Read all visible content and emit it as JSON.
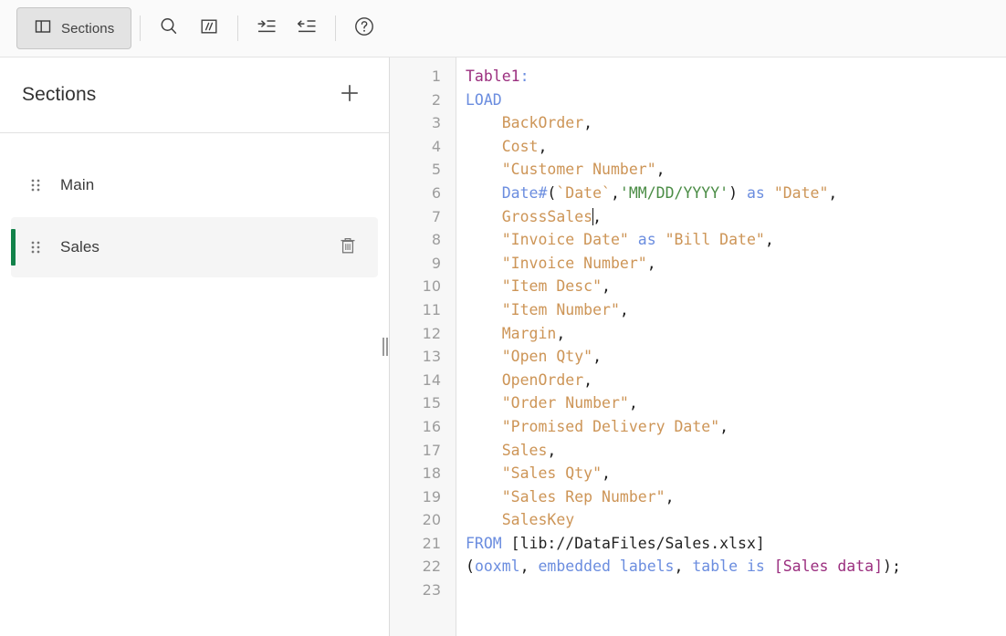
{
  "toolbar": {
    "sections_button": {
      "label": "Sections",
      "icon": "panel-layout-icon",
      "active": true
    },
    "buttons": [
      {
        "name": "search",
        "icon": "search-icon",
        "tooltip": "Search"
      },
      {
        "name": "comment",
        "icon": "comment-slashes-icon",
        "tooltip": "Comment"
      },
      {
        "name": "indent",
        "icon": "indent-right-icon",
        "tooltip": "Indent"
      },
      {
        "name": "outdent",
        "icon": "indent-left-icon",
        "tooltip": "Outdent"
      },
      {
        "name": "help",
        "icon": "help-question-icon",
        "tooltip": "Help"
      }
    ]
  },
  "sidebar": {
    "title": "Sections",
    "add_label": "+",
    "add_icon": "plus-icon",
    "accent_color": "#12824a",
    "items": [
      {
        "label": "Main",
        "selected": false,
        "deletable": false,
        "handle_icon": "drag-handle-icon"
      },
      {
        "label": "Sales",
        "selected": true,
        "deletable": true,
        "handle_icon": "drag-handle-icon",
        "delete_icon": "trash-icon"
      }
    ]
  },
  "splitter": {
    "name": "panel-splitter",
    "icon": "grip-vertical-icon"
  },
  "editor": {
    "language": "qlik-script",
    "cursor": {
      "line": 7,
      "column": 14
    },
    "line_numbers": [
      1,
      2,
      3,
      4,
      5,
      6,
      7,
      8,
      9,
      10,
      11,
      12,
      13,
      14,
      15,
      16,
      17,
      18,
      19,
      20,
      21,
      22,
      23
    ],
    "lines": [
      {
        "n": 1,
        "text": "Table1:",
        "tokens": [
          {
            "t": "Table1",
            "c": "t-table"
          },
          {
            "t": ":",
            "c": "t-kw"
          }
        ]
      },
      {
        "n": 2,
        "text": "LOAD",
        "tokens": [
          {
            "t": "LOAD",
            "c": "t-kw"
          }
        ]
      },
      {
        "n": 3,
        "text": "    BackOrder,",
        "tokens": [
          {
            "t": "    ",
            "c": "t-plain"
          },
          {
            "t": "BackOrder",
            "c": "t-field"
          },
          {
            "t": ",",
            "c": "t-punct"
          }
        ]
      },
      {
        "n": 4,
        "text": "    Cost,",
        "tokens": [
          {
            "t": "    ",
            "c": "t-plain"
          },
          {
            "t": "Cost",
            "c": "t-field"
          },
          {
            "t": ",",
            "c": "t-punct"
          }
        ]
      },
      {
        "n": 5,
        "text": "    \"Customer Number\",",
        "tokens": [
          {
            "t": "    ",
            "c": "t-plain"
          },
          {
            "t": "\"Customer Number\"",
            "c": "t-field"
          },
          {
            "t": ",",
            "c": "t-punct"
          }
        ]
      },
      {
        "n": 6,
        "text": "    Date#(`Date`,'MM/DD/YYYY') as \"Date\",",
        "tokens": [
          {
            "t": "    ",
            "c": "t-plain"
          },
          {
            "t": "Date#",
            "c": "t-kw"
          },
          {
            "t": "(",
            "c": "t-punct"
          },
          {
            "t": "`Date`",
            "c": "t-field"
          },
          {
            "t": ",",
            "c": "t-punct"
          },
          {
            "t": "'MM/DD/YYYY'",
            "c": "t-str"
          },
          {
            "t": ")",
            "c": "t-punct"
          },
          {
            "t": " ",
            "c": "t-plain"
          },
          {
            "t": "as",
            "c": "t-kw"
          },
          {
            "t": " ",
            "c": "t-plain"
          },
          {
            "t": "\"Date\"",
            "c": "t-field"
          },
          {
            "t": ",",
            "c": "t-punct"
          }
        ]
      },
      {
        "n": 7,
        "text": "    GrossSales,",
        "caret_after": "GrossSales",
        "tokens": [
          {
            "t": "    ",
            "c": "t-plain"
          },
          {
            "t": "GrossSales",
            "c": "t-field"
          },
          {
            "t": "CARET",
            "c": "caret"
          },
          {
            "t": ",",
            "c": "t-punct"
          }
        ]
      },
      {
        "n": 8,
        "text": "    \"Invoice Date\" as \"Bill Date\",",
        "tokens": [
          {
            "t": "    ",
            "c": "t-plain"
          },
          {
            "t": "\"Invoice Date\"",
            "c": "t-field"
          },
          {
            "t": " ",
            "c": "t-plain"
          },
          {
            "t": "as",
            "c": "t-kw"
          },
          {
            "t": " ",
            "c": "t-plain"
          },
          {
            "t": "\"Bill Date\"",
            "c": "t-field"
          },
          {
            "t": ",",
            "c": "t-punct"
          }
        ]
      },
      {
        "n": 9,
        "text": "    \"Invoice Number\",",
        "tokens": [
          {
            "t": "    ",
            "c": "t-plain"
          },
          {
            "t": "\"Invoice Number\"",
            "c": "t-field"
          },
          {
            "t": ",",
            "c": "t-punct"
          }
        ]
      },
      {
        "n": 10,
        "text": "    \"Item Desc\",",
        "tokens": [
          {
            "t": "    ",
            "c": "t-plain"
          },
          {
            "t": "\"Item Desc\"",
            "c": "t-field"
          },
          {
            "t": ",",
            "c": "t-punct"
          }
        ]
      },
      {
        "n": 11,
        "text": "    \"Item Number\",",
        "tokens": [
          {
            "t": "    ",
            "c": "t-plain"
          },
          {
            "t": "\"Item Number\"",
            "c": "t-field"
          },
          {
            "t": ",",
            "c": "t-punct"
          }
        ]
      },
      {
        "n": 12,
        "text": "    Margin,",
        "tokens": [
          {
            "t": "    ",
            "c": "t-plain"
          },
          {
            "t": "Margin",
            "c": "t-field"
          },
          {
            "t": ",",
            "c": "t-punct"
          }
        ]
      },
      {
        "n": 13,
        "text": "    \"Open Qty\",",
        "tokens": [
          {
            "t": "    ",
            "c": "t-plain"
          },
          {
            "t": "\"Open Qty\"",
            "c": "t-field"
          },
          {
            "t": ",",
            "c": "t-punct"
          }
        ]
      },
      {
        "n": 14,
        "text": "    OpenOrder,",
        "tokens": [
          {
            "t": "    ",
            "c": "t-plain"
          },
          {
            "t": "OpenOrder",
            "c": "t-field"
          },
          {
            "t": ",",
            "c": "t-punct"
          }
        ]
      },
      {
        "n": 15,
        "text": "    \"Order Number\",",
        "tokens": [
          {
            "t": "    ",
            "c": "t-plain"
          },
          {
            "t": "\"Order Number\"",
            "c": "t-field"
          },
          {
            "t": ",",
            "c": "t-punct"
          }
        ]
      },
      {
        "n": 16,
        "text": "    \"Promised Delivery Date\",",
        "tokens": [
          {
            "t": "    ",
            "c": "t-plain"
          },
          {
            "t": "\"Promised Delivery Date\"",
            "c": "t-field"
          },
          {
            "t": ",",
            "c": "t-punct"
          }
        ]
      },
      {
        "n": 17,
        "text": "    Sales,",
        "tokens": [
          {
            "t": "    ",
            "c": "t-plain"
          },
          {
            "t": "Sales",
            "c": "t-field"
          },
          {
            "t": ",",
            "c": "t-punct"
          }
        ]
      },
      {
        "n": 18,
        "text": "    \"Sales Qty\",",
        "tokens": [
          {
            "t": "    ",
            "c": "t-plain"
          },
          {
            "t": "\"Sales Qty\"",
            "c": "t-field"
          },
          {
            "t": ",",
            "c": "t-punct"
          }
        ]
      },
      {
        "n": 19,
        "text": "    \"Sales Rep Number\",",
        "tokens": [
          {
            "t": "    ",
            "c": "t-plain"
          },
          {
            "t": "\"Sales Rep Number\"",
            "c": "t-field"
          },
          {
            "t": ",",
            "c": "t-punct"
          }
        ]
      },
      {
        "n": 20,
        "text": "    SalesKey",
        "tokens": [
          {
            "t": "    ",
            "c": "t-plain"
          },
          {
            "t": "SalesKey",
            "c": "t-field"
          }
        ]
      },
      {
        "n": 21,
        "text": "FROM [lib://DataFiles/Sales.xlsx]",
        "tokens": [
          {
            "t": "FROM",
            "c": "t-kw"
          },
          {
            "t": " [lib://DataFiles/Sales.xlsx]",
            "c": "t-plain"
          }
        ]
      },
      {
        "n": 22,
        "text": "(ooxml, embedded labels, table is [Sales data]);",
        "tokens": [
          {
            "t": "(",
            "c": "t-punct"
          },
          {
            "t": "ooxml",
            "c": "t-kw"
          },
          {
            "t": ", ",
            "c": "t-punct"
          },
          {
            "t": "embedded labels",
            "c": "t-kw"
          },
          {
            "t": ", ",
            "c": "t-punct"
          },
          {
            "t": "table is",
            "c": "t-kw"
          },
          {
            "t": " ",
            "c": "t-plain"
          },
          {
            "t": "[Sales data]",
            "c": "t-bracket"
          },
          {
            "t": ");",
            "c": "t-punct"
          }
        ]
      },
      {
        "n": 23,
        "text": "",
        "tokens": []
      }
    ]
  }
}
